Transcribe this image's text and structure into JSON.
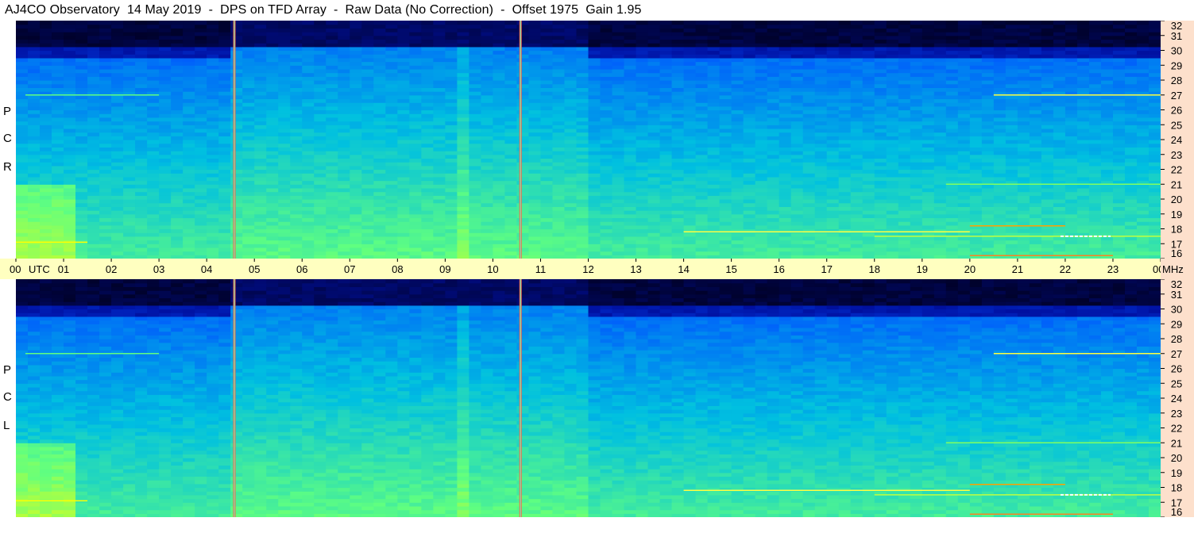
{
  "title": "AJ4CO Observatory  14 May 2019  -  DPS on TFD Array  -  Raw Data (No Correction)  -  Offset 1975  Gain 1.95",
  "polarization_labels": {
    "top": [
      "R",
      "C",
      "P"
    ],
    "bottom": [
      "L",
      "C",
      "P"
    ]
  },
  "time_axis": {
    "start_label": "00",
    "utc_label": "UTC",
    "end_label": "00",
    "unit_label": "MHz"
  },
  "colors": {
    "time_axis_bg": "#ffffc0",
    "freq_axis_bg": "#fde0cc",
    "marker_line": "#ff6040"
  },
  "chart_data": [
    {
      "type": "heatmap",
      "name": "RCP",
      "title": "AJ4CO Observatory  14 May 2019  -  DPS on TFD Array  -  Raw Data (No Correction)  -  Offset 1975  Gain 1.95",
      "xlabel": "UTC",
      "ylabel": "MHz",
      "xlim": [
        0,
        24
      ],
      "ylim": [
        16,
        32
      ],
      "x_ticks": [
        "00",
        "01",
        "02",
        "03",
        "04",
        "05",
        "06",
        "07",
        "08",
        "09",
        "10",
        "11",
        "12",
        "13",
        "14",
        "15",
        "16",
        "17",
        "18",
        "19",
        "20",
        "21",
        "22",
        "23",
        "00"
      ],
      "y_ticks": [
        16,
        17,
        18,
        19,
        20,
        21,
        22,
        23,
        24,
        25,
        26,
        27,
        28,
        29,
        30,
        31,
        32
      ],
      "colormap": [
        "#000020",
        "#0010a0",
        "#0050ff",
        "#00c0e0",
        "#60ff80",
        "#ffff00",
        "#ff4000"
      ],
      "markers_utc": [
        4.58,
        10.58
      ]
    },
    {
      "type": "heatmap",
      "name": "LCP",
      "xlabel": "UTC",
      "ylabel": "MHz",
      "xlim": [
        0,
        24
      ],
      "ylim": [
        16,
        32
      ],
      "x_ticks": [
        "00",
        "01",
        "02",
        "03",
        "04",
        "05",
        "06",
        "07",
        "08",
        "09",
        "10",
        "11",
        "12",
        "13",
        "14",
        "15",
        "16",
        "17",
        "18",
        "19",
        "20",
        "21",
        "22",
        "23",
        "00"
      ],
      "y_ticks": [
        16,
        17,
        18,
        19,
        20,
        21,
        22,
        23,
        24,
        25,
        26,
        27,
        28,
        29,
        30,
        31,
        32
      ],
      "colormap": [
        "#000020",
        "#0010a0",
        "#0050ff",
        "#00c0e0",
        "#60ff80",
        "#ffff00",
        "#ff4000"
      ],
      "markers_utc": [
        4.58,
        10.58
      ]
    }
  ]
}
